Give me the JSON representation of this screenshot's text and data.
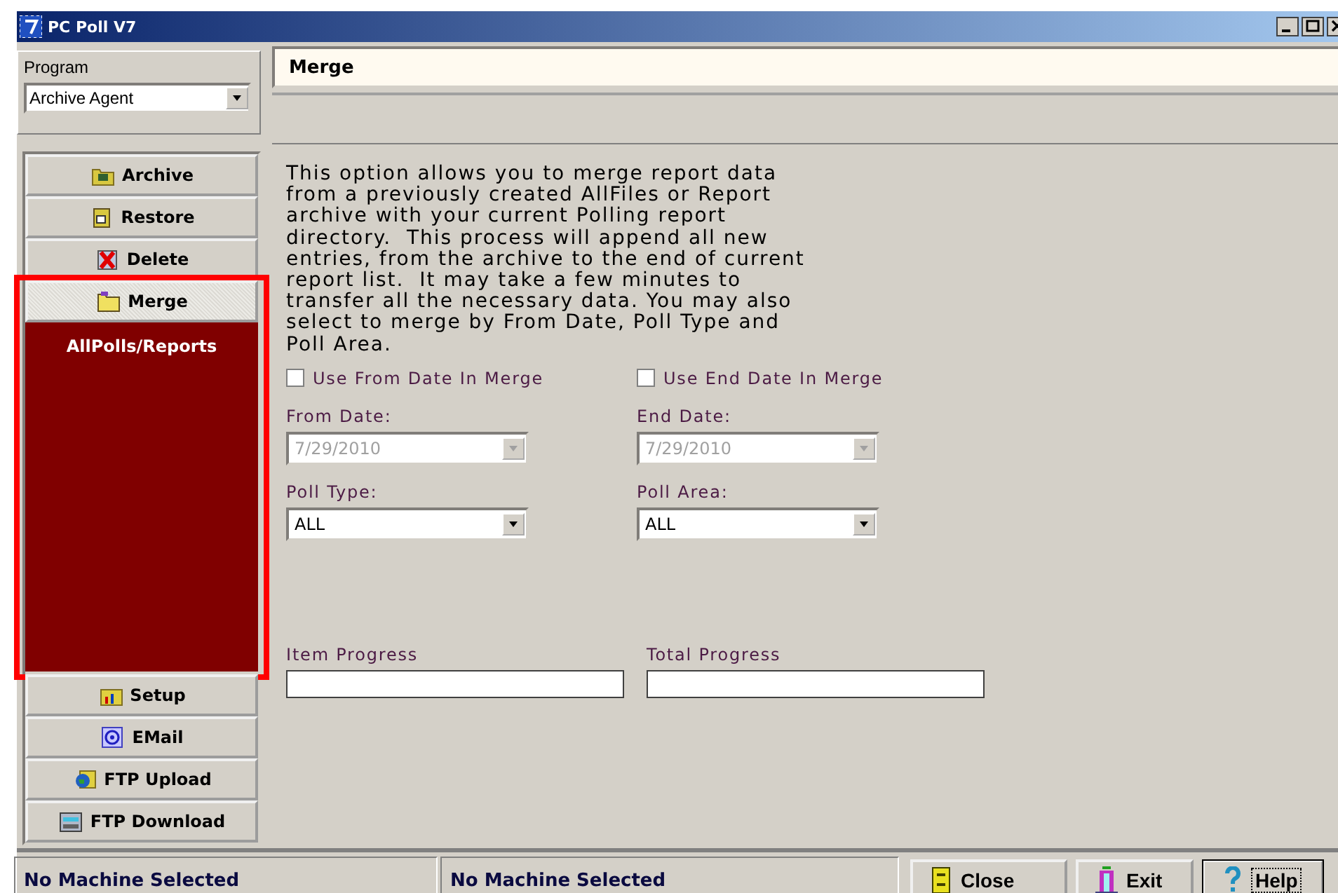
{
  "window": {
    "title": "PC Poll V7"
  },
  "program": {
    "label": "Program",
    "value": "Archive Agent"
  },
  "nav": [
    {
      "label": "Archive",
      "selected": false,
      "highlighted": false
    },
    {
      "label": "Restore",
      "selected": false,
      "highlighted": false
    },
    {
      "label": "Delete",
      "selected": false,
      "highlighted": false
    },
    {
      "label": "Merge",
      "selected": true,
      "highlighted": true,
      "children": [
        {
          "label": "AllPolls/Reports",
          "selected": false
        }
      ]
    },
    {
      "label": "Setup",
      "selected": false,
      "highlighted": false
    },
    {
      "label": "EMail",
      "selected": false,
      "highlighted": false
    },
    {
      "label": "FTP Upload",
      "selected": false,
      "highlighted": false
    },
    {
      "label": "FTP Download",
      "selected": false,
      "highlighted": false
    }
  ],
  "panel": {
    "title": "Merge"
  },
  "description": "This option allows you to merge report data from a previously created AllFiles or Report archive with your current Polling report directory.  This process will append all new entries, from the archive to the end of current report list.  It may take a few minutes to transfer all the necessary data. You may also select to merge by From Date, Poll Type and Poll Area.",
  "options": [
    {
      "label": "Use From Date In Merge",
      "checked": false
    },
    {
      "label": "Use End Date In Merge",
      "checked": false
    }
  ],
  "fields": [
    {
      "label": "From Date:",
      "value": "7/29/2010",
      "disabled": true
    },
    {
      "label": "End Date:",
      "value": "7/29/2010",
      "disabled": true
    },
    {
      "label": "Poll Type:",
      "value": "ALL",
      "disabled": false
    },
    {
      "label": "Poll Area:",
      "value": "ALL",
      "disabled": false
    }
  ],
  "progress": [
    {
      "label": "Item Progress",
      "level": 0
    },
    {
      "label": "Total Progress",
      "level": 0
    }
  ],
  "status_bar": [
    "No Machine Selected",
    "No Machine Selected"
  ],
  "buttons": [
    {
      "label": "Close",
      "focused": false
    },
    {
      "label": "Exit",
      "focused": false
    },
    {
      "label": "Help",
      "focused": true
    }
  ]
}
